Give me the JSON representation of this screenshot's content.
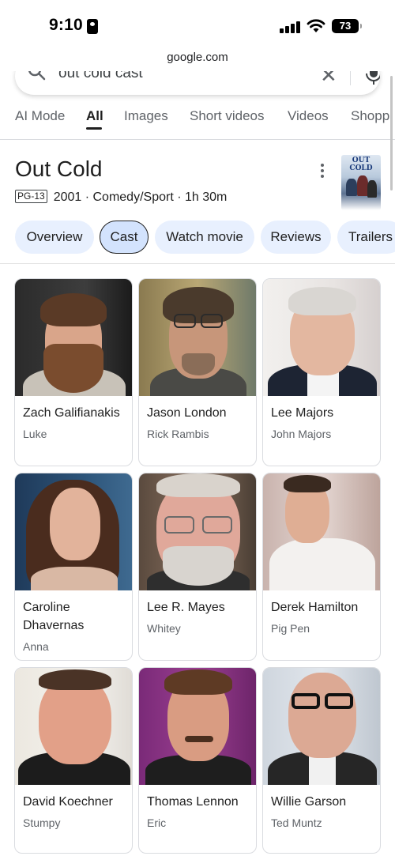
{
  "status_bar": {
    "time": "9:10",
    "battery": "73"
  },
  "browser": {
    "url": "google.com"
  },
  "search": {
    "query": "out cold cast"
  },
  "tabs": [
    {
      "label": "AI Mode"
    },
    {
      "label": "All"
    },
    {
      "label": "Images"
    },
    {
      "label": "Short videos"
    },
    {
      "label": "Videos"
    },
    {
      "label": "Shoppi"
    }
  ],
  "movie": {
    "title": "Out Cold",
    "rating": "PG-13",
    "meta": "2001 · Comedy/Sport · 1h 30m",
    "poster_text": "OUT COLD"
  },
  "chips": [
    {
      "label": "Overview"
    },
    {
      "label": "Cast"
    },
    {
      "label": "Watch movie"
    },
    {
      "label": "Reviews"
    },
    {
      "label": "Trailers"
    }
  ],
  "cast": [
    {
      "name": "Zach Galifianakis",
      "role": "Luke"
    },
    {
      "name": "Jason London",
      "role": "Rick Rambis"
    },
    {
      "name": "Lee Majors",
      "role": "John Majors"
    },
    {
      "name": "Caroline Dhavernas",
      "role": "Anna"
    },
    {
      "name": "Lee R. Mayes",
      "role": "Whitey"
    },
    {
      "name": "Derek Hamilton",
      "role": "Pig Pen"
    },
    {
      "name": "David Koechner",
      "role": "Stumpy"
    },
    {
      "name": "Thomas Lennon",
      "role": "Eric"
    },
    {
      "name": "Willie Garson",
      "role": "Ted Muntz"
    }
  ],
  "colors": {
    "chip_bg": "#e8f0fe",
    "chip_active_bg": "#d3e3fd",
    "text": "#1f1f1f",
    "secondary": "#5f6368"
  }
}
